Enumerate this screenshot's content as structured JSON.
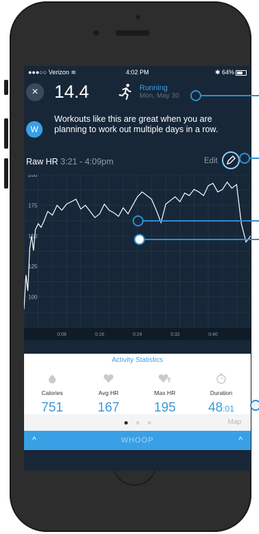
{
  "status_bar": {
    "carrier": "●●●○○ Verizon ≋",
    "time": "4:02 PM",
    "battery": "✱ 64%"
  },
  "header": {
    "close_icon": "×",
    "strain_value": "14.4",
    "activity_name": "Running",
    "activity_date": "Mon, May 30"
  },
  "coach": {
    "avatar_letter": "W",
    "message": "Workouts like this are great when you are planning to work out multiple days in a row."
  },
  "hr_section": {
    "title_prefix": "Raw HR",
    "time_range": "3:21 - 4:09pm",
    "edit_label": "Edit"
  },
  "stats": {
    "title": "Activity Statistics",
    "items": [
      {
        "icon": "flame-icon",
        "label": "Calories",
        "value": "751"
      },
      {
        "icon": "heart-icon",
        "label": "Avg HR",
        "value": "167"
      },
      {
        "icon": "heart-up-icon",
        "label": "Max HR",
        "value": "195"
      },
      {
        "icon": "stopwatch-icon",
        "label": "Duration",
        "value": "48",
        "value_suffix": ":01"
      }
    ]
  },
  "pager": {
    "pages": 3,
    "active": 0,
    "map_label": "Map"
  },
  "bottom_bar": {
    "brand": "WHOOP"
  },
  "colors": {
    "accent": "#3aa0e6",
    "background": "#172738",
    "line": "#ffffff",
    "callout": "#2d8fd1"
  },
  "chart_data": {
    "type": "line",
    "title": "",
    "xlabel": "",
    "ylabel": "",
    "x_tick_labels": [
      "0:08",
      "0:16",
      "0:24",
      "0:32",
      "0:40"
    ],
    "x_ticks": [
      8,
      16,
      24,
      32,
      40
    ],
    "y_tick_labels": [
      "100",
      "125",
      "150",
      "175",
      "200"
    ],
    "y_ticks": [
      100,
      125,
      150,
      175,
      200
    ],
    "xlim": [
      0,
      48
    ],
    "ylim": [
      75,
      200
    ],
    "grid": true,
    "series": [
      {
        "x": [
          0,
          0.4,
          0.8,
          1.2,
          1.6,
          2.0,
          2.4,
          3,
          3.6,
          4.2,
          5,
          6,
          7,
          8,
          9,
          10,
          11,
          12,
          13,
          14,
          15,
          16,
          17,
          18,
          19,
          20,
          21,
          22,
          23,
          24,
          25,
          26,
          27,
          28,
          29,
          30,
          31,
          32,
          33,
          34,
          35,
          36,
          37,
          38,
          39,
          40,
          41,
          42,
          43,
          44,
          45,
          46,
          47,
          48
        ],
        "y": [
          90,
          118,
          105,
          140,
          150,
          138,
          155,
          160,
          157,
          162,
          170,
          167,
          175,
          171,
          176,
          178,
          180,
          172,
          175,
          170,
          165,
          168,
          176,
          171,
          169,
          166,
          173,
          168,
          175,
          182,
          186,
          183,
          180,
          171,
          161,
          176,
          179,
          182,
          178,
          185,
          183,
          188,
          186,
          183,
          191,
          193,
          186,
          188,
          194,
          189,
          192,
          160,
          145,
          150
        ]
      }
    ]
  }
}
